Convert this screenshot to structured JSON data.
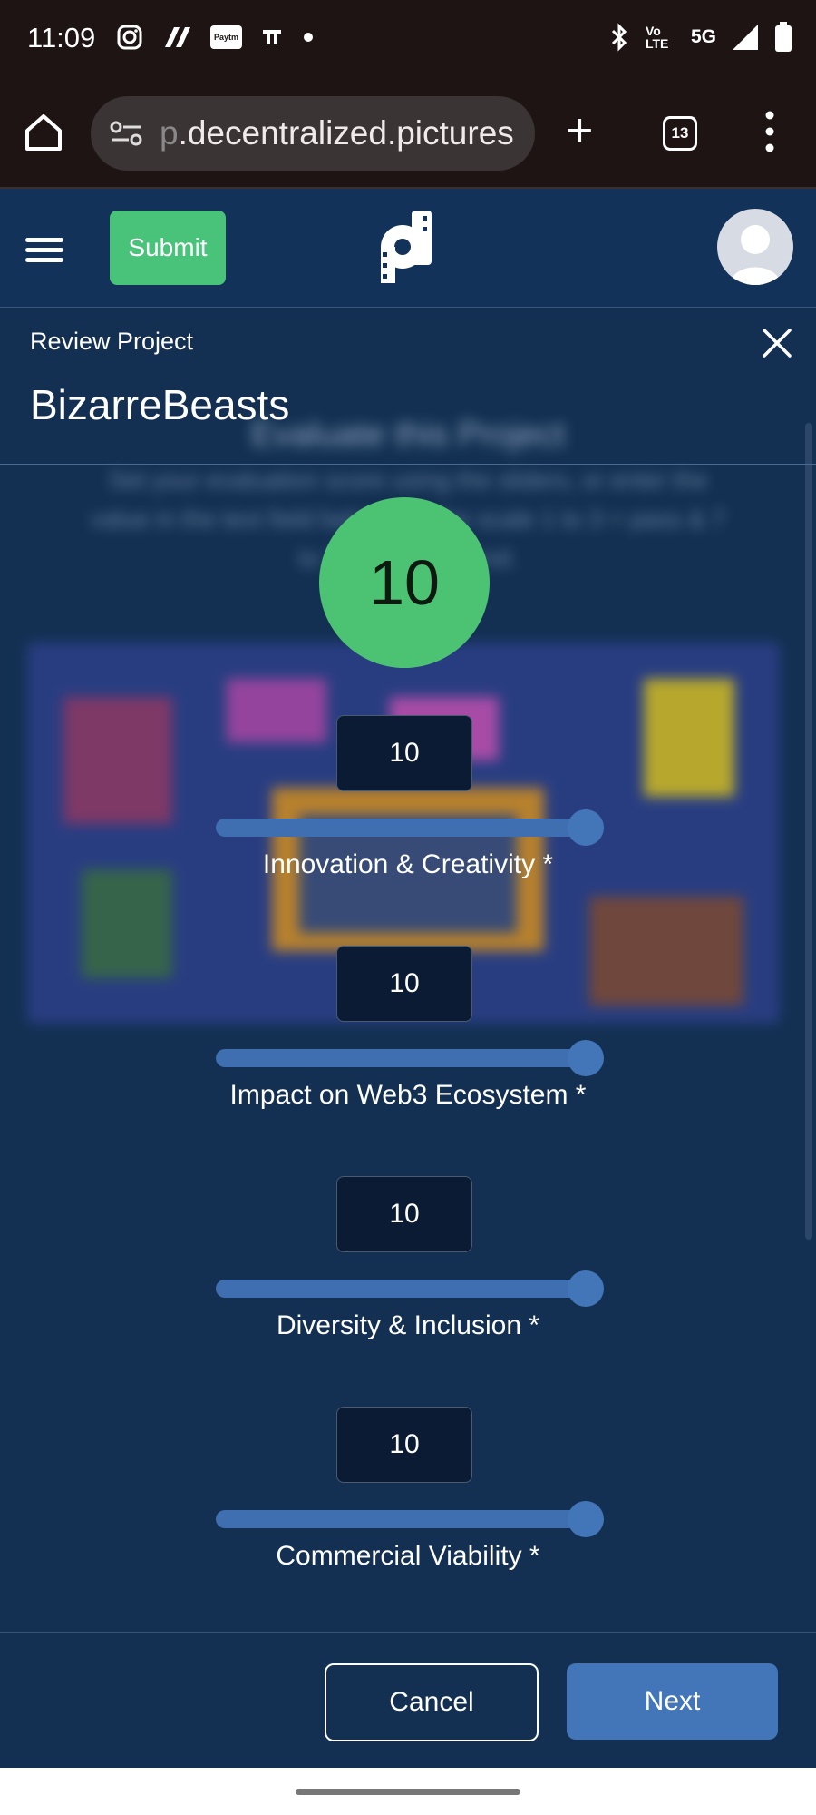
{
  "status_bar": {
    "time": "11:09",
    "left_icons": [
      "instagram-icon",
      "flipkart-icon",
      "paytm-icon",
      "mail-icon",
      "dot-icon"
    ],
    "paytm_label": "Paytm",
    "right_icons": [
      "bluetooth-icon",
      "volte-icon",
      "signal-icon",
      "battery-icon"
    ],
    "volte_label": "Vo LTE",
    "network": "5G"
  },
  "browser": {
    "url_faded": "p",
    "url_main": ".decentralized.pictures",
    "tab_count": "13"
  },
  "app_header": {
    "submit_label": "Submit"
  },
  "background": {
    "title": "Evaluate this Project",
    "description": "Set your evaluation score using the sliders, or enter the value in the text field below. On the scale 1 to 3 = pass & 7 to 10 = recommend."
  },
  "modal": {
    "review_label": "Review Project",
    "project_name": "BizarreBeasts",
    "total_score": "10",
    "criteria": [
      {
        "label": "Innovation & Creativity *",
        "value": "10",
        "fraction": 1.0
      },
      {
        "label": "Impact on Web3 Ecosystem *",
        "value": "10",
        "fraction": 1.0
      },
      {
        "label": "Diversity & Inclusion *",
        "value": "10",
        "fraction": 1.0
      },
      {
        "label": "Commercial Viability *",
        "value": "10",
        "fraction": 1.0
      }
    ],
    "cancel_label": "Cancel",
    "next_label": "Next"
  },
  "colors": {
    "app_bg": "#133052",
    "submit_green": "#49c27a",
    "score_green": "#4cc273",
    "slider_blue": "#4276b8"
  }
}
